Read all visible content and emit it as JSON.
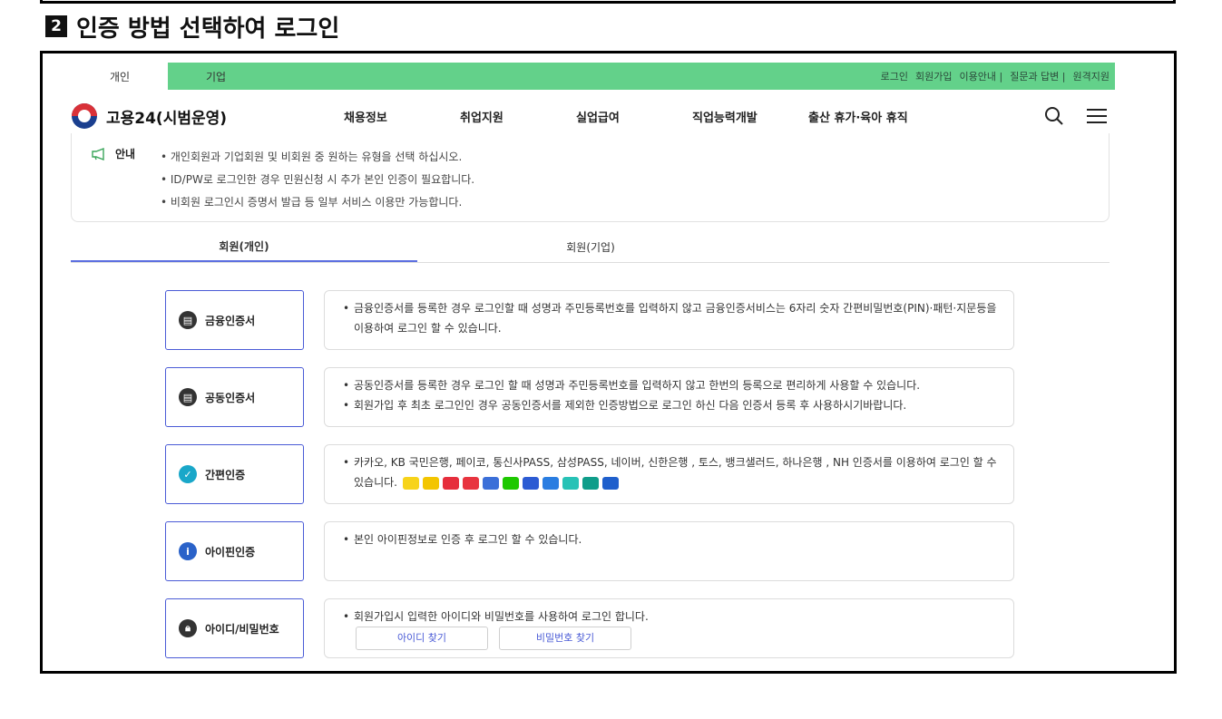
{
  "step": {
    "number": "2",
    "title": "인증 방법 선택하여 로그인"
  },
  "topbar": {
    "tabs": [
      {
        "label": "개인"
      },
      {
        "label": "기업"
      }
    ],
    "links": [
      "로그인",
      "회원가입",
      "이용안내 |",
      "질문과 답변 |",
      "원격지원"
    ]
  },
  "header": {
    "logo_text": "고용24(시범운영)",
    "nav": [
      "채용정보",
      "취업지원",
      "실업급여",
      "직업능력개발",
      "출산 휴가·육아 휴직"
    ]
  },
  "notice": {
    "label": "안내",
    "items": [
      "• 개인회원과 기업회원 및 비회원 중 원하는 유형을 선택 하십시오.",
      "• ID/PW로 로그인한 경우 민원신청 시 추가 본인 인증이 필요합니다.",
      "• 비회원 로그인시 증명서 발급 등 일부 서비스 이용만 가능합니다."
    ]
  },
  "tabs": [
    {
      "label": "회원(개인)"
    },
    {
      "label": "회원(기업)"
    }
  ],
  "methods": [
    {
      "label": "금융인증서",
      "icon": "certificate-icon",
      "color": "#333333",
      "lines": [
        "금융인증서를 등록한 경우 로그인할 때 성명과 주민등록번호를 입력하지 않고 금융인증서비스는 6자리 숫자 간편비밀번호(PIN)·패턴·지문등을 이용하여 로그인 할 수 있습니다."
      ]
    },
    {
      "label": "공동인증서",
      "icon": "certificate-icon",
      "color": "#333333",
      "lines": [
        "공동인증서를 등록한 경우 로그인 할 때 성명과 주민등록번호를 입력하지 않고 한번의 등록으로 편리하게 사용할 수 있습니다.",
        "회원가입 후 최초 로그인인 경우 공동인증서를 제외한 인증방법으로 로그인 하신 다음 인증서 등록 후 사용하시기바랍니다."
      ]
    },
    {
      "label": "간편인증",
      "icon": "check-shield-icon",
      "color": "#19a7c9",
      "lines": [
        "카카오, KB 국민은행, 페이코, 통신사PASS, 삼성PASS, 네이버, 신한은행 , 토스, 뱅크샐러드, 하나은행 , NH 인증서를 이용하여 로그인 할 수 있습니다."
      ]
    },
    {
      "label": "아이핀인증",
      "icon": "info-icon",
      "color": "#2a62c9",
      "lines": [
        "본인 아이핀정보로 인증 후 로그인 할 수 있습니다."
      ]
    },
    {
      "label": "아이디/비밀번호",
      "icon": "lock-icon",
      "color": "#333333",
      "lines": [
        "회원가입시 입력한 아이디와 비밀번호를 사용하여 로그인 합니다."
      ],
      "buttons": [
        "아이디 찾기",
        "비밀번호 찾기"
      ]
    }
  ],
  "bank_icons": [
    "#f7d31a",
    "#f3c500",
    "#e62e3c",
    "#e8343f",
    "#3b6fd8",
    "#1ec800",
    "#2c5bd3",
    "#2a7de1",
    "#27c2b6",
    "#0f9d8a",
    "#1f5fcc"
  ]
}
